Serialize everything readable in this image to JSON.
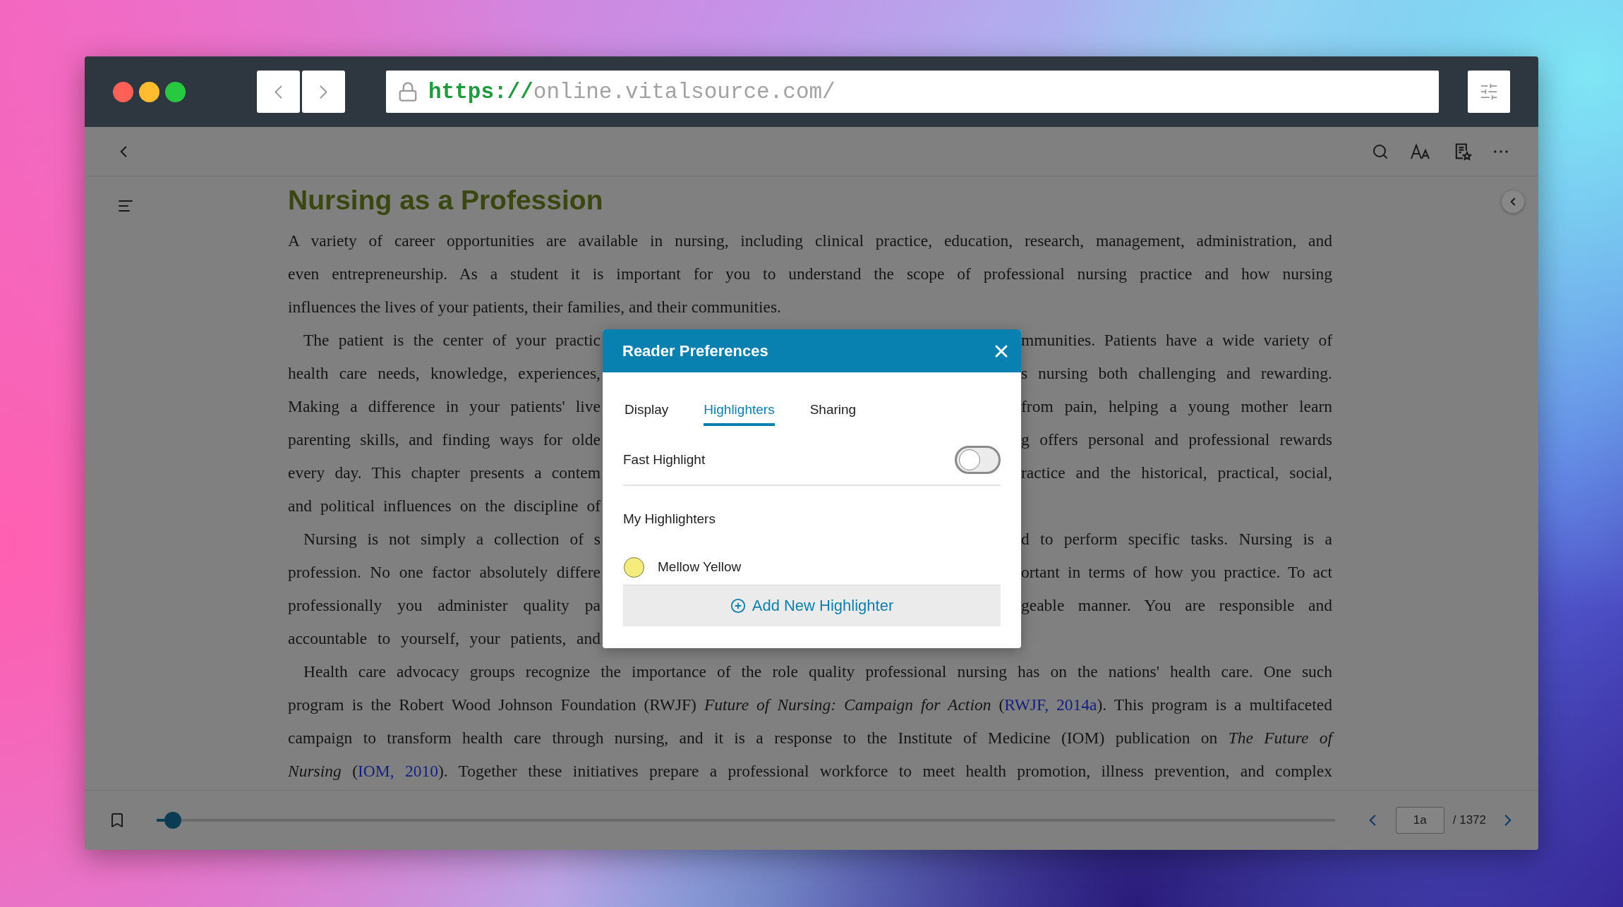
{
  "browser": {
    "url_scheme": "https://",
    "url_host": "online.vitalsource.com/"
  },
  "book": {
    "title": "Nursing as a Profession",
    "lines": [
      {
        "kind": "full",
        "indent": false,
        "left": [
          {
            "kind": "text",
            "text": "A variety of career opportunities are available in nursing, including clinical practice, education, research, management, administration, and"
          }
        ]
      },
      {
        "kind": "full",
        "indent": false,
        "left": [
          {
            "kind": "text",
            "text": "even entrepreneurship. As a student it is important for you to understand the scope of professional nursing practice and how nursing"
          }
        ]
      },
      {
        "kind": "last",
        "indent": false,
        "left": [
          {
            "kind": "text",
            "text": "influences the lives of your patients, their families, and their communities."
          }
        ]
      },
      {
        "kind": "split",
        "indent": true,
        "left": [
          {
            "kind": "text",
            "text": "The patient is the center of your practic"
          }
        ],
        "right": [
          {
            "kind": "text",
            "text": "mmunities. Patients have a wide variety of"
          }
        ]
      },
      {
        "kind": "split",
        "indent": false,
        "left": [
          {
            "kind": "text",
            "text": "health care needs, knowledge, experiences,"
          }
        ],
        "right": [
          {
            "kind": "text",
            "text": "s nursing both challenging and rewarding."
          }
        ]
      },
      {
        "kind": "split",
        "indent": false,
        "left": [
          {
            "kind": "text",
            "text": "Making a difference in your patients' live"
          }
        ],
        "right": [
          {
            "kind": "text",
            "text": "from pain, helping a young mother learn"
          }
        ]
      },
      {
        "kind": "split",
        "indent": false,
        "left": [
          {
            "kind": "text",
            "text": "parenting skills, and finding ways for olde"
          }
        ],
        "right": [
          {
            "kind": "text",
            "text": "g offers personal and professional rewards"
          }
        ]
      },
      {
        "kind": "split",
        "indent": false,
        "left": [
          {
            "kind": "text",
            "text": "every day. This chapter presents a contem"
          }
        ],
        "right": [
          {
            "kind": "text",
            "text": "ractice and the historical, practical, social,"
          }
        ]
      },
      {
        "kind": "split",
        "indent": false,
        "left": [
          {
            "kind": "text",
            "text": "and political influences on the discipline of"
          }
        ]
      },
      {
        "kind": "split",
        "indent": true,
        "left": [
          {
            "kind": "text",
            "text": "Nursing is not simply a collection of s"
          }
        ],
        "right": [
          {
            "kind": "text",
            "text": "d to perform specific tasks. Nursing is a"
          }
        ]
      },
      {
        "kind": "split",
        "indent": false,
        "left": [
          {
            "kind": "text",
            "text": "profession. No one factor absolutely differe"
          }
        ],
        "right": [
          {
            "kind": "text",
            "text": "ortant in terms of how you practice. To act"
          }
        ]
      },
      {
        "kind": "split",
        "indent": false,
        "left": [
          {
            "kind": "text",
            "text": "professionally you administer quality pa"
          }
        ],
        "right": [
          {
            "kind": "text",
            "text": "geable manner. You are responsible and"
          }
        ]
      },
      {
        "kind": "split",
        "indent": false,
        "left": [
          {
            "kind": "text",
            "text": "accountable to yourself, your patients, and"
          }
        ]
      },
      {
        "kind": "full",
        "indent": true,
        "left": [
          {
            "kind": "text",
            "text": "Health care advocacy groups recognize the importance of the role quality professional nursing has on the nations' health care. One such"
          }
        ]
      },
      {
        "kind": "full",
        "indent": false,
        "left": [
          {
            "kind": "text",
            "text": "program is the Robert Wood Johnson Foundation (RWJF) *Future of Nursing: Campaign for Action* ("
          },
          {
            "kind": "link",
            "text": "RWJF, 2014a"
          },
          {
            "kind": "text",
            "text": "). This program is a multifaceted"
          }
        ]
      },
      {
        "kind": "full",
        "indent": false,
        "left": [
          {
            "kind": "text",
            "text": "campaign to transform health care through nursing, and it is a response to the Institute of Medicine (IOM) publication on *The Future of*"
          }
        ]
      },
      {
        "kind": "full",
        "indent": false,
        "left": [
          {
            "kind": "text",
            "text": "*Nursing* ("
          },
          {
            "kind": "link",
            "text": "IOM, 2010"
          },
          {
            "kind": "text",
            "text": "). Together these initiatives prepare a professional workforce to meet health promotion, illness prevention, and complex"
          }
        ]
      }
    ]
  },
  "dialog": {
    "title": "Reader Preferences",
    "tabs": [
      {
        "label": "Display",
        "selected": false
      },
      {
        "label": "Highlighters",
        "selected": true
      },
      {
        "label": "Sharing",
        "selected": false
      }
    ],
    "settings": [
      {
        "label": "Fast Highlight",
        "on": false
      }
    ],
    "section_title": "My Highlighters",
    "highlighters": [
      {
        "name": "Mellow Yellow",
        "color": "#f4ec7c"
      }
    ],
    "add_button": "Add New Highlighter"
  },
  "footer": {
    "level": 0.014,
    "page_value": "1a",
    "page_total": "/ 1372"
  }
}
